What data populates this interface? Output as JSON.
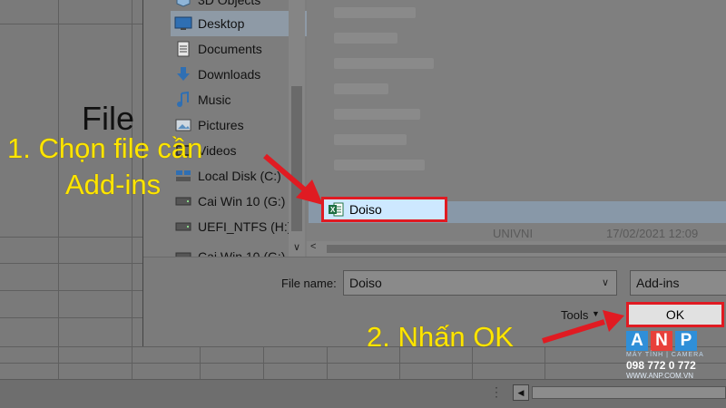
{
  "background": {
    "file_text": "File"
  },
  "nav": {
    "items": [
      {
        "label": "3D Objects",
        "icon": "cube-3d-icon"
      },
      {
        "label": "Desktop",
        "icon": "desktop-icon"
      },
      {
        "label": "Documents",
        "icon": "documents-icon"
      },
      {
        "label": "Downloads",
        "icon": "downloads-icon"
      },
      {
        "label": "Music",
        "icon": "music-icon"
      },
      {
        "label": "Pictures",
        "icon": "pictures-icon"
      },
      {
        "label": "Videos",
        "icon": "videos-icon"
      },
      {
        "label": "Local Disk (C:)",
        "icon": "disk-icon"
      },
      {
        "label": "Cai Win 10 (G:)",
        "icon": "drive-icon"
      },
      {
        "label": "UEFI_NTFS (H:)",
        "icon": "drive-icon"
      },
      {
        "label": "Cai Win 10 (G:)",
        "icon": "drive-icon"
      }
    ],
    "selected": "Desktop"
  },
  "files": {
    "selected_file": "Doiso",
    "ghost_file": "UNIVNI",
    "ghost_date": "17/02/2021 12:09"
  },
  "dialog": {
    "file_name_label": "File name:",
    "file_name_value": "Doiso",
    "file_type_value": "Add-ins",
    "tools_label": "Tools",
    "ok_label": "OK"
  },
  "annotations": {
    "step1_line1": "1. Chọn file cần",
    "step1_line2": "Add-ins",
    "step2": "2. Nhấn OK"
  },
  "logo": {
    "letters": [
      "A",
      "N",
      "P"
    ],
    "letter_colors": [
      "#2f8fd8",
      "#e8403a",
      "#2f8fd8"
    ],
    "subtitle": "MÁY TÍNH | CAMERA",
    "phone": "098 772 0 772",
    "website": "WWW.ANP.COM.VN"
  },
  "colors": {
    "highlight_border": "#e01b22",
    "annotation": "#ffe500",
    "arrow": "#e01b22"
  }
}
